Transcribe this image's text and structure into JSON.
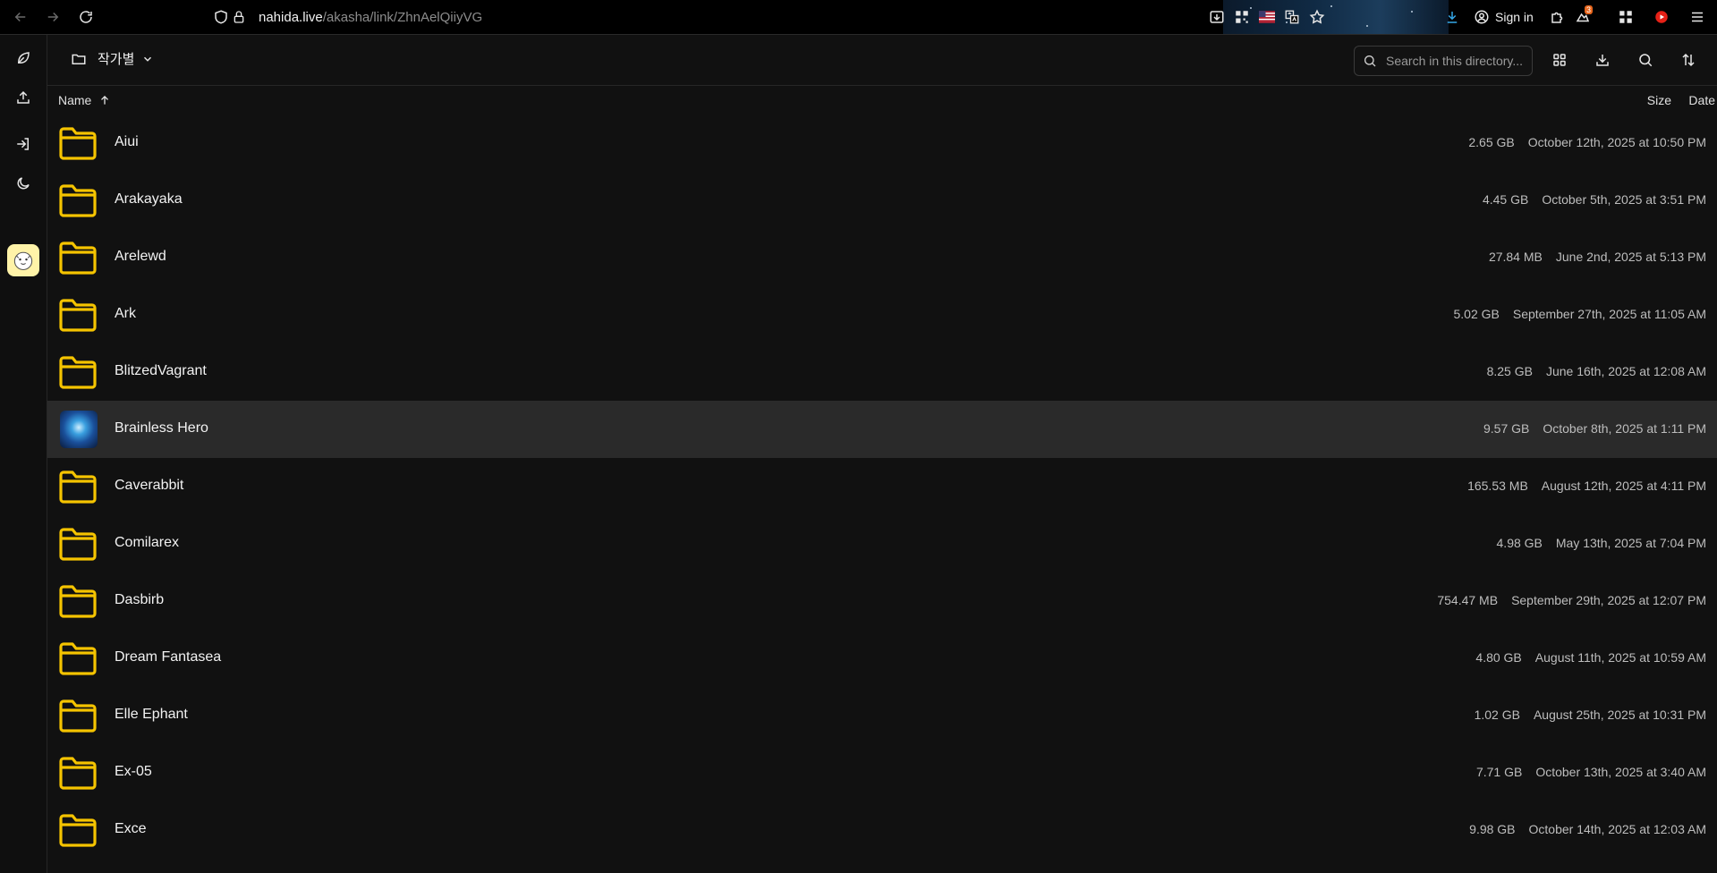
{
  "browser": {
    "url_host": "nahida.live",
    "url_path": "/akasha/link/ZhnAelQiiyVG",
    "signin_label": "Sign in",
    "badge_count": "3"
  },
  "header": {
    "folder_title": "작가별",
    "search_placeholder": "Search in this directory..."
  },
  "columns": {
    "name": "Name",
    "size": "Size",
    "date": "Date"
  },
  "rows": [
    {
      "name": "Aiui",
      "size": "2.65 GB",
      "date": "October 12th, 2025 at 10:50 PM"
    },
    {
      "name": "Arakayaka",
      "size": "4.45 GB",
      "date": "October 5th, 2025 at 3:51 PM"
    },
    {
      "name": "Arelewd",
      "size": "27.84 MB",
      "date": "June 2nd, 2025 at 5:13 PM"
    },
    {
      "name": "Ark",
      "size": "5.02 GB",
      "date": "September 27th, 2025 at 11:05 AM"
    },
    {
      "name": "BlitzedVagrant",
      "size": "8.25 GB",
      "date": "June 16th, 2025 at 12:08 AM"
    },
    {
      "name": "Brainless Hero",
      "size": "9.57 GB",
      "date": "October 8th, 2025 at 1:11 PM"
    },
    {
      "name": "Caverabbit",
      "size": "165.53 MB",
      "date": "August 12th, 2025 at 4:11 PM"
    },
    {
      "name": "Comilarex",
      "size": "4.98 GB",
      "date": "May 13th, 2025 at 7:04 PM"
    },
    {
      "name": "Dasbirb",
      "size": "754.47 MB",
      "date": "September 29th, 2025 at 12:07 PM"
    },
    {
      "name": "Dream Fantasea",
      "size": "4.80 GB",
      "date": "August 11th, 2025 at 10:59 AM"
    },
    {
      "name": "Elle Ephant",
      "size": "1.02 GB",
      "date": "August 25th, 2025 at 10:31 PM"
    },
    {
      "name": "Ex-05",
      "size": "7.71 GB",
      "date": "October 13th, 2025 at 3:40 AM"
    },
    {
      "name": "Exce",
      "size": "9.98 GB",
      "date": "October 14th, 2025 at 12:03 AM"
    }
  ],
  "colors": {
    "folder": "#f5c400",
    "bg": "#111111",
    "highlight": "#2a2a2a"
  }
}
